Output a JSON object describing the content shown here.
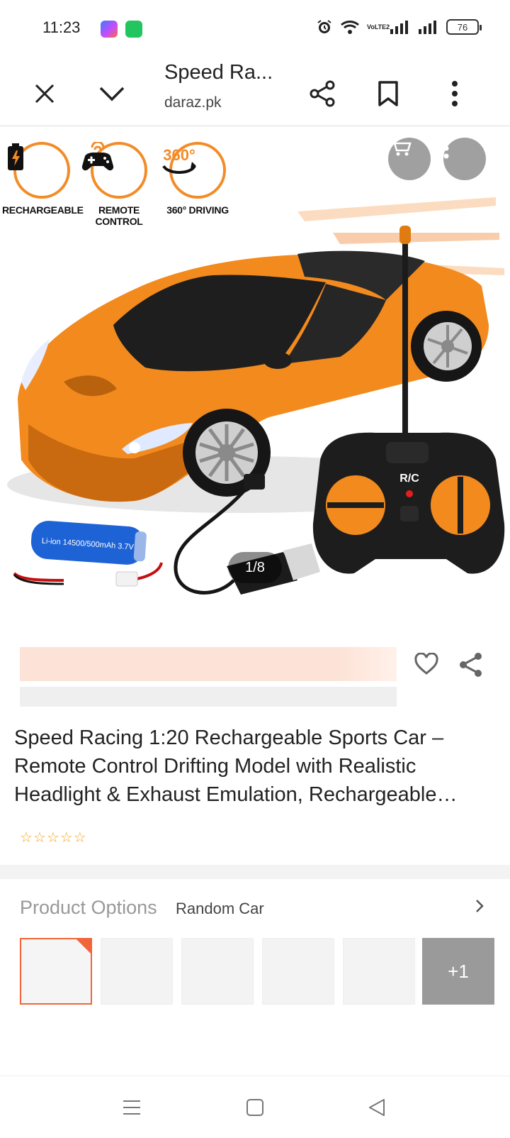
{
  "status_bar": {
    "time": "11:23",
    "network_label": "VoLTE2",
    "battery": "76"
  },
  "top_bar": {
    "title": "Speed Ra...",
    "domain": "daraz.pk"
  },
  "hero": {
    "features": [
      {
        "label": "RECHARGEABLE",
        "icon": "battery-icon"
      },
      {
        "label": "REMOTE CONTROL",
        "icon": "gamepad-icon"
      },
      {
        "label": "360° DRIVING",
        "icon": "rotate-360-icon"
      }
    ],
    "badge_360": "360°",
    "remote_label": "R/C",
    "battery_cell_text": "Li-ion 14500/500mAh 3.7V",
    "image_counter": "1/8"
  },
  "product": {
    "title": "Speed Racing 1:20 Rechargeable Sports Car – Remote Control Drifting Model with Realistic Headlight & Exhaust Emulation, Rechargeable…",
    "rating_stars": 0,
    "stars_total": 5
  },
  "options": {
    "label": "Product Options",
    "value": "Random Car",
    "more_count": "+1"
  },
  "colors": {
    "accent": "#f0663a",
    "car_orange": "#f28a1e",
    "star": "#f5a623"
  }
}
